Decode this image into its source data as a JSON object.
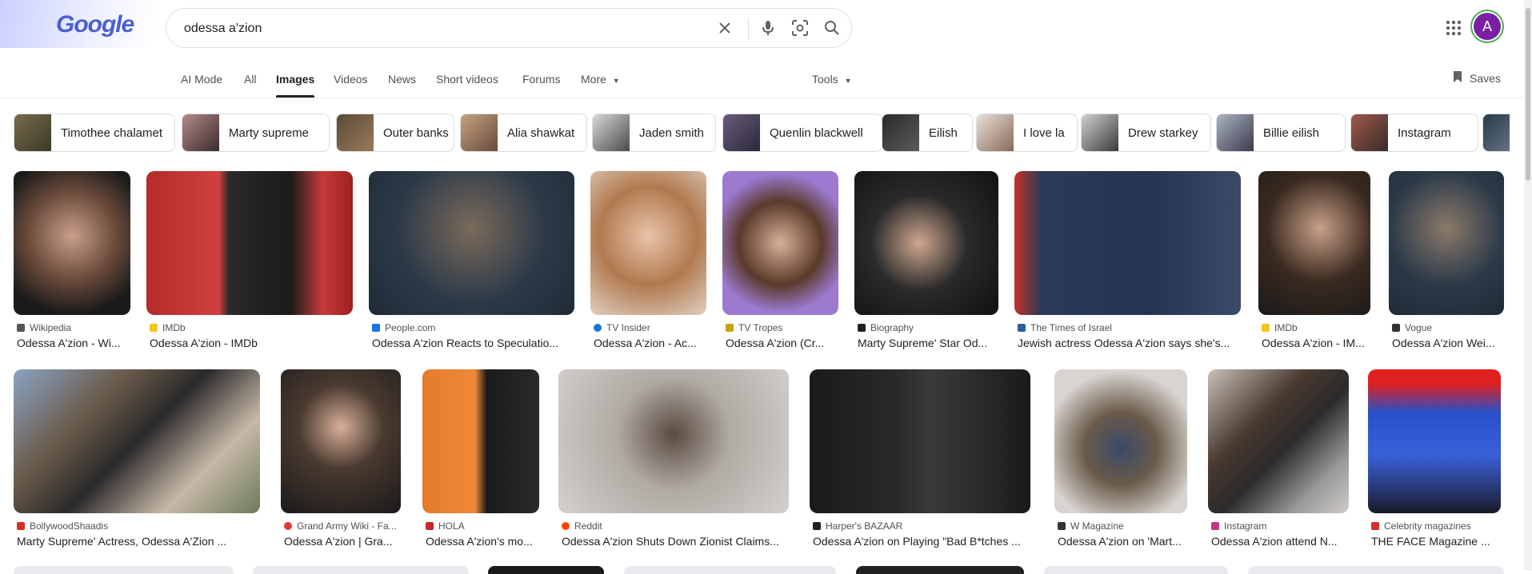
{
  "search": {
    "query": "odessa a'zion"
  },
  "logo": {
    "text": "Google"
  },
  "user": {
    "avatar_letter": "A"
  },
  "tabs": [
    {
      "label": "AI Mode"
    },
    {
      "label": "All"
    },
    {
      "label": "Images"
    },
    {
      "label": "Videos"
    },
    {
      "label": "News"
    },
    {
      "label": "Short videos"
    },
    {
      "label": "Forums"
    },
    {
      "label": "More"
    }
  ],
  "tools": {
    "label": "Tools"
  },
  "saves": {
    "label": "Saves"
  },
  "chips": [
    {
      "label": "Timothee chalamet"
    },
    {
      "label": "Marty supreme"
    },
    {
      "label": "Outer banks"
    },
    {
      "label": "Alia shawkat"
    },
    {
      "label": "Jaden smith"
    },
    {
      "label": "Quenlin blackwell"
    },
    {
      "label": "Eilish"
    },
    {
      "label": "I love la"
    },
    {
      "label": "Drew starkey"
    },
    {
      "label": "Billie eilish"
    },
    {
      "label": "Instagram"
    },
    {
      "label": ""
    }
  ],
  "results_row1": [
    {
      "source": "Wikipedia",
      "title": "Odessa A'zion - Wi...",
      "fav_color": "#555555"
    },
    {
      "source": "IMDb",
      "title": "Odessa A'zion - IMDb",
      "fav_color": "#f5c518"
    },
    {
      "source": "People.com",
      "title": "Odessa A'zion Reacts to Speculatio...",
      "fav_color": "#1a73e8"
    },
    {
      "source": "TV Insider",
      "title": "Odessa A'zion - Ac...",
      "fav_color": "#1976d2"
    },
    {
      "source": "TV Tropes",
      "title": "Odessa A'zion (Cr...",
      "fav_color": "#c9a100"
    },
    {
      "source": "Biography",
      "title": "Marty Supreme' Star Od...",
      "fav_color": "#222222"
    },
    {
      "source": "The Times of Israel",
      "title": "Jewish actress Odessa A'zion says she's...",
      "fav_color": "#2d5c9f"
    },
    {
      "source": "IMDb",
      "title": "Odessa A'zion - IM...",
      "fav_color": "#f5c518"
    },
    {
      "source": "Vogue",
      "title": "Odessa A'zion Wei...",
      "fav_color": "#333333"
    }
  ],
  "results_row2": [
    {
      "source": "BollywoodShaadis",
      "title": "Marty Supreme' Actress, Odessa A'Zion ...",
      "fav_color": "#d93025"
    },
    {
      "source": "Grand Army Wiki - Fa...",
      "title": "Odessa A'zion | Gra...",
      "fav_color": "#e53935"
    },
    {
      "source": "HOLA",
      "title": "Odessa A'zion's mo...",
      "fav_color": "#c62828"
    },
    {
      "source": "Reddit",
      "title": "Odessa A'zion Shuts Down Zionist Claims...",
      "fav_color": "#ff4500"
    },
    {
      "source": "Harper's BAZAAR",
      "title": "Odessa A'zion on Playing \"Bad B*tches ...",
      "fav_color": "#222222"
    },
    {
      "source": "W Magazine",
      "title": "Odessa A'zion on 'Mart...",
      "fav_color": "#333333"
    },
    {
      "source": "Instagram",
      "title": "Odessa A'zion attend N...",
      "fav_color": "#c13584"
    },
    {
      "source": "Celebrity magazines",
      "title": "THE FACE Magazine ...",
      "fav_color": "#d32f2f"
    }
  ],
  "colors": {
    "accent": "#1a73e8",
    "text": "#202124",
    "muted": "#4d5156",
    "border": "#dadce0"
  }
}
